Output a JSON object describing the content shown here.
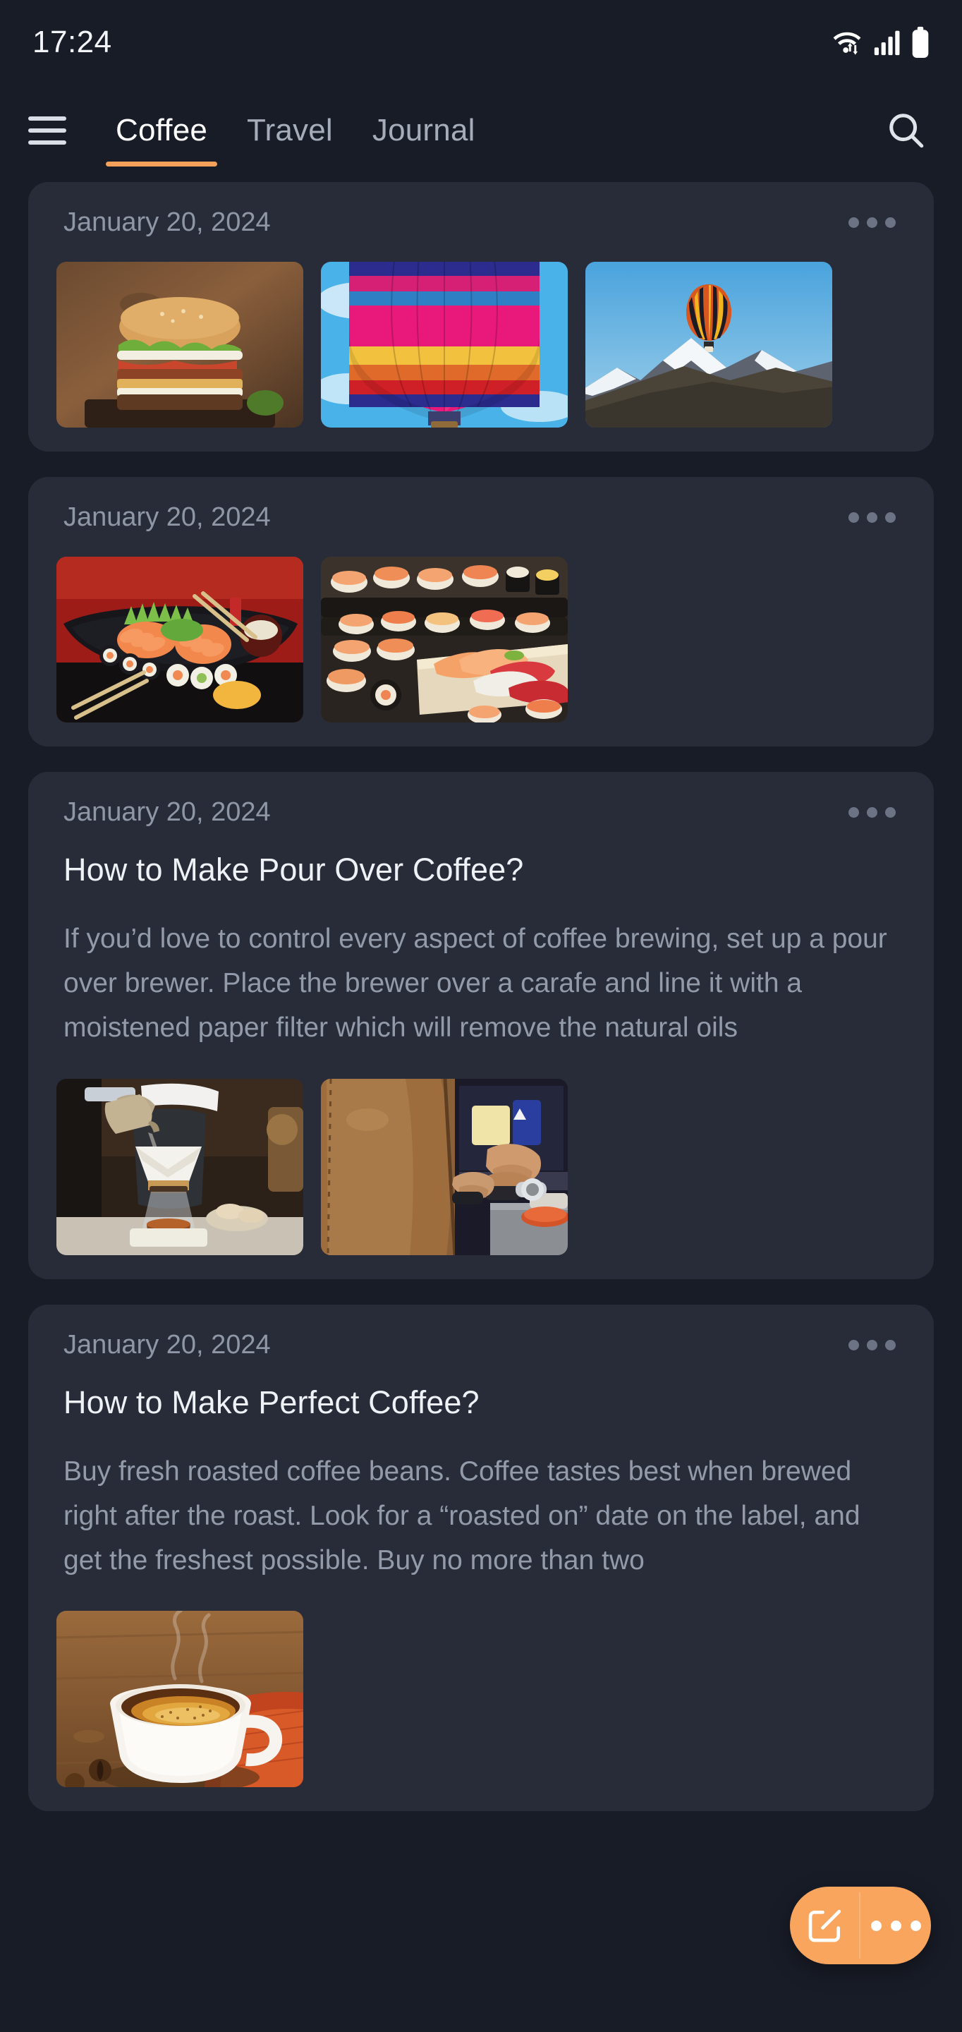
{
  "status_bar": {
    "time": "17:24",
    "icons": [
      "wifi-icon",
      "cellular-signal-icon",
      "battery-icon"
    ]
  },
  "navbar": {
    "menu_icon": "hamburger-menu-icon",
    "search_icon": "search-icon",
    "tabs": [
      {
        "label": "Coffee",
        "active": true
      },
      {
        "label": "Travel",
        "active": false
      },
      {
        "label": "Journal",
        "active": false
      }
    ]
  },
  "theme": {
    "page_background": "#181c27",
    "card_background": "#272c38",
    "accent": "#f6a15a",
    "fab_background": "#f9a55d",
    "title_color": "#eef1f6",
    "body_color": "#939bab",
    "date_color": "#8f97a6"
  },
  "feed": {
    "entries": [
      {
        "date": "January 20, 2024",
        "menu_icon": "more-options-icon",
        "title": "",
        "body": "",
        "images": [
          "burger-photo",
          "hot-air-balloon-closeup-photo",
          "hot-air-balloon-over-mountain-photo"
        ]
      },
      {
        "date": "January 20, 2024",
        "menu_icon": "more-options-icon",
        "title": "",
        "body": "",
        "images": [
          "sushi-sashimi-boat-photo",
          "sushi-platter-photo"
        ]
      },
      {
        "date": "January 20, 2024",
        "menu_icon": "more-options-icon",
        "title": "How to Make Pour Over Coffee?",
        "body": "If you’d love to control every aspect of coffee brewing, set up a pour over brewer. Place the brewer over a carafe and line it with a moistened paper filter which will remove the natural oils",
        "images": [
          "pour-over-brewing-photo",
          "barista-tamping-photo"
        ]
      },
      {
        "date": "January 20, 2024",
        "menu_icon": "more-options-icon",
        "title": "How to Make Perfect Coffee?",
        "body": "Buy fresh roasted coffee beans. Coffee tastes best when brewed right after the roast. Look for a “roasted on” date on the label, and get the freshest possible. Buy no more than two",
        "images": [
          "coffee-cup-photo"
        ]
      }
    ]
  },
  "fab": {
    "compose_icon": "compose-edit-icon",
    "more_icon": "more-options-icon"
  }
}
